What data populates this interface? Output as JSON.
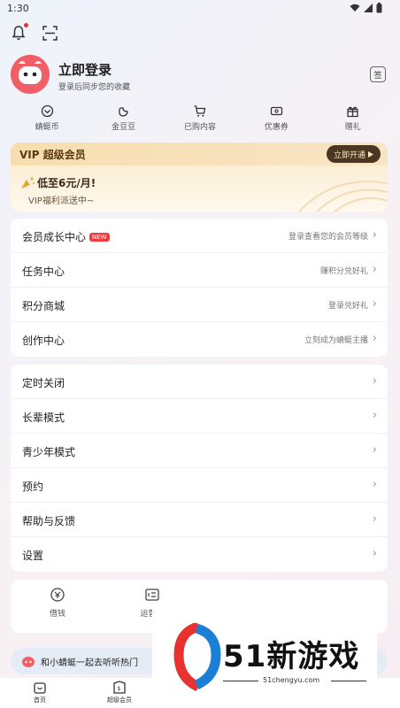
{
  "status_bar": {
    "time": "1:30"
  },
  "profile": {
    "title": "立即登录",
    "subtitle": "登录后同步您的收藏",
    "checkin_label": "签"
  },
  "quick_links": [
    {
      "icon": "dragonfly-coin-icon",
      "label": "蜻蜓币"
    },
    {
      "icon": "golden-bean-icon",
      "label": "金豆豆"
    },
    {
      "icon": "cart-icon",
      "label": "已购内容"
    },
    {
      "icon": "coupon-icon",
      "label": "优惠券"
    },
    {
      "icon": "gift-icon",
      "label": "赠礼"
    }
  ],
  "vip": {
    "title": "VIP 超级会员",
    "button": "立即开通",
    "promo": "低至6元/月!",
    "desc": "VIP福利派送中~"
  },
  "menu_group1": [
    {
      "label": "会员成长中心",
      "badge": "NEW",
      "right": "登录查看您的会员等级"
    },
    {
      "label": "任务中心",
      "right": "赚积分兑好礼"
    },
    {
      "label": "积分商城",
      "right": "登录兑好礼"
    },
    {
      "label": "创作中心",
      "right": "立刻成为蜻蜓主播"
    }
  ],
  "menu_group2": [
    {
      "label": "定时关闭"
    },
    {
      "label": "长辈模式"
    },
    {
      "label": "青少年模式"
    },
    {
      "label": "预约"
    },
    {
      "label": "帮助与反馈"
    },
    {
      "label": "设置"
    }
  ],
  "tools": [
    {
      "icon": "wallet-icon",
      "label": "借钱"
    },
    {
      "icon": "operator-icon",
      "label": "运营商"
    }
  ],
  "promo_bar": {
    "text": "和小蜻蜓一起去听听热门"
  },
  "bottom_nav": [
    {
      "icon": "home-icon",
      "label": "首页"
    },
    {
      "icon": "vip-bag-icon",
      "label": "超级会员"
    }
  ],
  "watermark": {
    "text": "51新游戏",
    "url": "51chengyu.com"
  },
  "colors": {
    "accent_red": "#e7322f",
    "vip_dark": "#4b3621",
    "vip_gold": "#f9e6c0"
  }
}
